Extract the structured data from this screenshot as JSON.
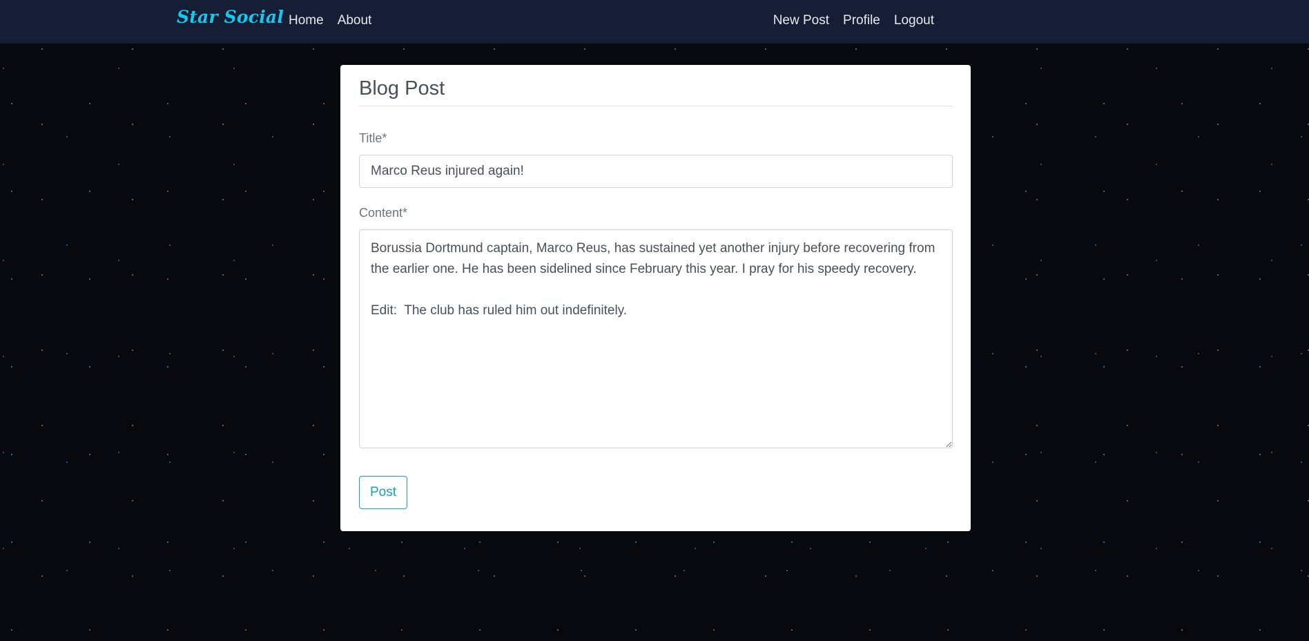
{
  "navbar": {
    "brand": "Star Social",
    "left_links": [
      "Home",
      "About"
    ],
    "right_links": [
      "New Post",
      "Profile",
      "Logout"
    ]
  },
  "form": {
    "heading": "Blog Post",
    "title_label": "Title*",
    "title_value": "Marco Reus injured again!",
    "content_label": "Content*",
    "content_value": "Borussia Dortmund captain, Marco Reus, has sustained yet another injury before recovering from the earlier one. He has been sidelined since February this year. I pray for his speedy recovery.\n\nEdit:  The club has ruled him out indefinitely.",
    "submit_label": "Post"
  },
  "colors": {
    "navbar_bg": "#151e35",
    "brand": "#16c8f0",
    "button_accent": "#17a2b8"
  }
}
